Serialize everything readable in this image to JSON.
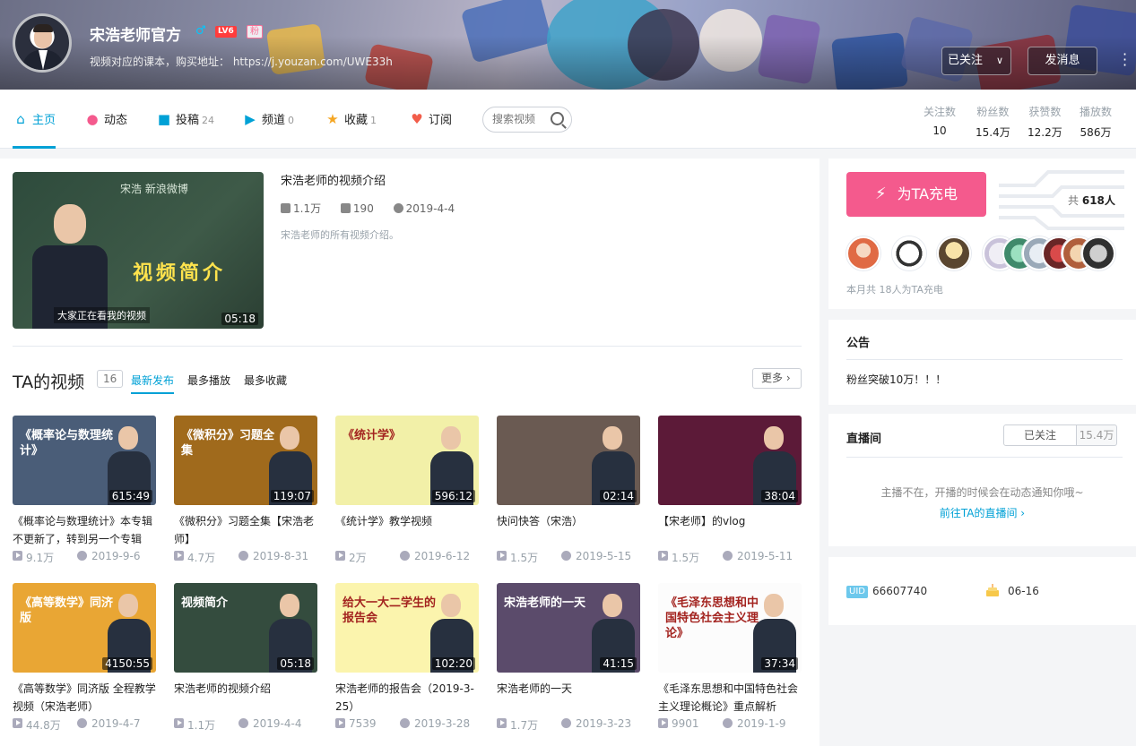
{
  "profile": {
    "name": "宋浩老师官方",
    "level": "LV6",
    "fan_badge": "粉",
    "sign": "视频对应的课本，购买地址：   https://j.youzan.com/UWE33h",
    "follow_btn": "已关注",
    "message_btn": "发消息"
  },
  "nav": {
    "home": "主页",
    "dynamic": "动态",
    "upload": "投稿",
    "upload_count": "24",
    "channel": "频道",
    "channel_count": "0",
    "fav": "收藏",
    "fav_count": "1",
    "subscribe": "订阅",
    "search_placeholder": "搜索视频"
  },
  "stats": [
    {
      "label": "关注数",
      "value": "10"
    },
    {
      "label": "粉丝数",
      "value": "15.4万"
    },
    {
      "label": "获赞数",
      "value": "12.2万"
    },
    {
      "label": "播放数",
      "value": "586万"
    }
  ],
  "featured": {
    "thumb_board": "宋浩  新浪微博",
    "thumb_title": "视频简介",
    "thumb_caption": "大家正在看我的视频",
    "duration": "05:18",
    "title": "宋浩老师的视频介绍",
    "views": "1.1万",
    "danmaku": "190",
    "date": "2019-4-4",
    "desc": "宋浩老师的所有视频介绍。"
  },
  "videos_section": {
    "title": "TA的视频",
    "count": "16",
    "tabs": [
      "最新发布",
      "最多播放",
      "最多收藏"
    ],
    "more": "更多"
  },
  "videos": [
    {
      "thumb_text": "《概率论与数理统计》",
      "duration": "615:49",
      "title": "《概率论与数理统计》本专辑不更新了，转到另一个专辑",
      "views": "9.1万",
      "date": "2019-9-6",
      "bg": "#4a5d78"
    },
    {
      "thumb_text": "《微积分》习题全集",
      "duration": "119:07",
      "title": "《微积分》习题全集【宋浩老师】",
      "views": "4.7万",
      "date": "2019-8-31",
      "bg": "#a06a1c"
    },
    {
      "thumb_text": "《统计学》",
      "duration": "596:12",
      "title": "《统计学》教学视频",
      "views": "2万",
      "date": "2019-6-12",
      "bg": "#f2f0a8"
    },
    {
      "thumb_text": "",
      "duration": "02:14",
      "title": "快问快答（宋浩）",
      "views": "1.5万",
      "date": "2019-5-15",
      "bg": "#6a5a52"
    },
    {
      "thumb_text": "",
      "duration": "38:04",
      "title": "【宋老师】的vlog",
      "views": "1.5万",
      "date": "2019-5-11",
      "bg": "#5c1a38"
    },
    {
      "thumb_text": "《高等数学》同济版",
      "duration": "4150:55",
      "title": "《高等数学》同济版 全程教学视频（宋浩老师）",
      "views": "44.8万",
      "date": "2019-4-7",
      "bg": "#e9a634"
    },
    {
      "thumb_text": "视频简介",
      "duration": "05:18",
      "title": "宋浩老师的视频介绍",
      "views": "1.1万",
      "date": "2019-4-4",
      "bg": "#344c3e"
    },
    {
      "thumb_text": "给大一大二学生的报告会",
      "duration": "102:20",
      "title": "宋浩老师的报告会（2019-3-25）",
      "views": "7539",
      "date": "2019-3-28",
      "bg": "#fbf4ad"
    },
    {
      "thumb_text": "宋浩老师的一天",
      "duration": "41:15",
      "title": "宋浩老师的一天",
      "views": "1.7万",
      "date": "2019-3-23",
      "bg": "#5b4b6b"
    },
    {
      "thumb_text": "《毛泽东思想和中国特色社会主义理论》",
      "duration": "37:34",
      "title": "《毛泽东思想和中国特色社会主义理论概论》重点解析",
      "views": "9901",
      "date": "2019-1-9",
      "bg": "#fcfcfc"
    }
  ],
  "charge": {
    "button": "为TA充电",
    "total_prefix": "共",
    "total": "618人",
    "note": "本月共 18人为TA充电"
  },
  "notice": {
    "title": "公告",
    "text": "粉丝突破10万！！！"
  },
  "live": {
    "title": "直播间",
    "follow": "已关注",
    "count": "15.4万",
    "empty": "主播不在，开播的时候会在动态通知你哦~",
    "link": "前往TA的直播间  ›"
  },
  "info": {
    "uid_label": "UID",
    "uid": "66607740",
    "birthday": "06-16"
  },
  "colors": {
    "accent": "#00a1d6",
    "charge": "#f45a8d"
  }
}
